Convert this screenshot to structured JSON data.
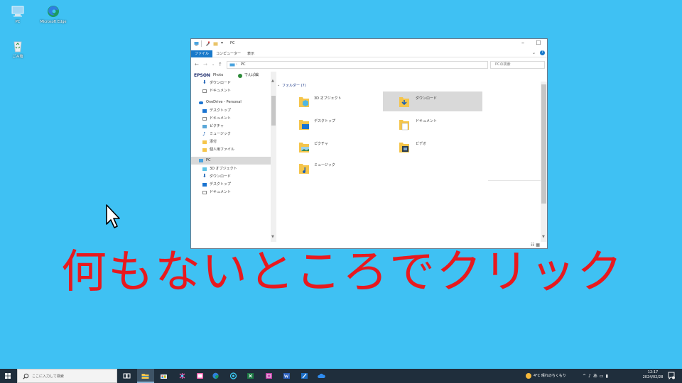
{
  "desktop": {
    "icons": [
      {
        "label": "PC"
      },
      {
        "label": "Microsoft Edge"
      },
      {
        "label": "ごみ箱"
      }
    ]
  },
  "window": {
    "title": "PC",
    "ribbon_tabs": [
      "ファイル",
      "コンピューター",
      "表示"
    ],
    "address": "PC",
    "search_placeholder": "PCの検索",
    "nav_items": [
      {
        "label": "ダウンロード"
      },
      {
        "label": "ドキュメント"
      },
      {
        "label": "OneDrive - Personal"
      },
      {
        "label": "デスクトップ"
      },
      {
        "label": "ドキュメント"
      },
      {
        "label": "ピクチャ"
      },
      {
        "label": "ミュージック"
      },
      {
        "label": "添付"
      },
      {
        "label": "個人用ファイル"
      },
      {
        "label": "PC"
      },
      {
        "label": "3D オブジェクト"
      },
      {
        "label": "ダウンロード"
      },
      {
        "label": "デスクトップ"
      },
      {
        "label": "ドキュメント"
      }
    ],
    "nav_header": "EPSON",
    "nav_header_sub": "Photo",
    "nav_header_extra": "でんぱ編",
    "group_header": "フォルダー (7)",
    "folders": [
      {
        "label": "3D オブジェクト"
      },
      {
        "label": "ダウンロード"
      },
      {
        "label": "デスクトップ"
      },
      {
        "label": "ドキュメント"
      },
      {
        "label": "ピクチャ"
      },
      {
        "label": "ビデオ"
      },
      {
        "label": "ミュージック"
      }
    ]
  },
  "caption": "何もないところでクリック",
  "taskbar": {
    "search_placeholder": "ここに入力して検索",
    "weather": "4°C 晴れのちくもり",
    "clock_time": "12:17",
    "clock_date": "2024/02/28",
    "tray_ime": "あ"
  },
  "colors": {
    "desktop_bg": "#3fc1f3",
    "caption": "#e8191e",
    "taskbar": "#1f2e3c",
    "accent": "#1979ca",
    "folder": "#f5c54b"
  }
}
